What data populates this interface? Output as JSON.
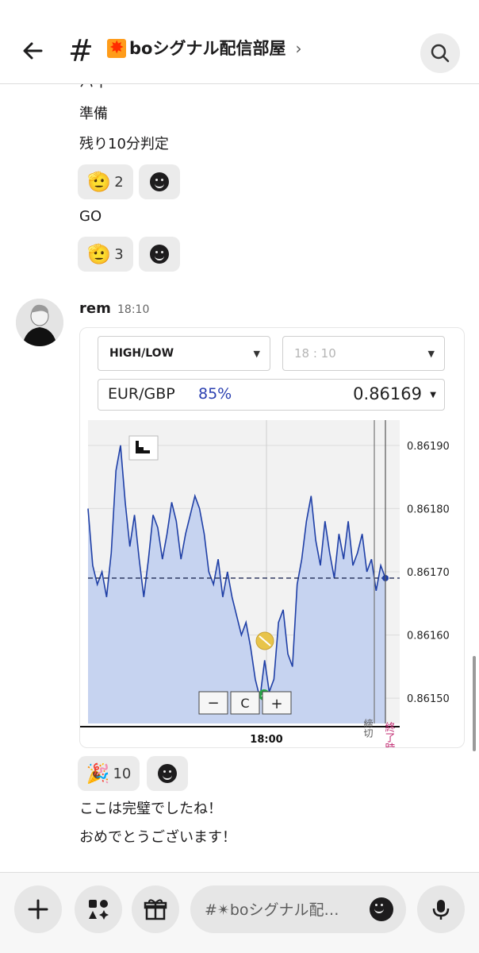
{
  "header": {
    "channel_prefix": "#",
    "channel_name": "boシグナル配信部屋",
    "chevron": "›"
  },
  "messages": {
    "partial_line": "ハイ",
    "line_1": "準備",
    "line_2": "残り10分判定",
    "reaction_1": {
      "emoji": "🫡",
      "count": "2"
    },
    "line_3": "GO",
    "reaction_2": {
      "emoji": "🫡",
      "count": "3"
    }
  },
  "post": {
    "username": "rem",
    "time": "18:10",
    "reaction": {
      "emoji": "🎉",
      "count": "10"
    },
    "text_1": "ここは完璧でしたね！",
    "text_2": "おめでとうございます！"
  },
  "trade_widget": {
    "mode": "HIGH/LOW",
    "expiry": "18 : 10",
    "pair": "EUR/GBP",
    "payout": "85%",
    "price": "0.86169"
  },
  "chart_data": {
    "type": "area",
    "title": "",
    "xlabel": "",
    "ylabel": "",
    "x_tick_labels": [
      "18:00"
    ],
    "y_tick_labels": [
      "0.86190",
      "0.86180",
      "0.86170",
      "0.86160",
      "0.86150"
    ],
    "ylim": [
      0.86146,
      0.86194
    ],
    "current_price_line": 0.86169,
    "vertical_labels": [
      "締切",
      "終了時刻"
    ],
    "zoom_controls": [
      "−",
      "C",
      "+"
    ],
    "series": [
      {
        "values": [
          0.8618,
          0.86171,
          0.86168,
          0.8617,
          0.86166,
          0.86173,
          0.86186,
          0.8619,
          0.86181,
          0.86174,
          0.86179,
          0.86172,
          0.86166,
          0.86172,
          0.86179,
          0.86177,
          0.86172,
          0.86176,
          0.86181,
          0.86178,
          0.86172,
          0.86176,
          0.86179,
          0.86182,
          0.8618,
          0.86176,
          0.8617,
          0.86168,
          0.86172,
          0.86166,
          0.8617,
          0.86166,
          0.86163,
          0.8616,
          0.86162,
          0.86158,
          0.86153,
          0.8615,
          0.86156,
          0.86151,
          0.86153,
          0.86162,
          0.86164,
          0.86157,
          0.86155,
          0.86168,
          0.86172,
          0.86178,
          0.86182,
          0.86175,
          0.86171,
          0.86178,
          0.86173,
          0.86169,
          0.86176,
          0.86172,
          0.86178,
          0.86171,
          0.86173,
          0.86176,
          0.8617,
          0.86172,
          0.86167,
          0.86171,
          0.86169
        ]
      }
    ]
  },
  "composer": {
    "placeholder": "#✴boシグナル配…"
  }
}
